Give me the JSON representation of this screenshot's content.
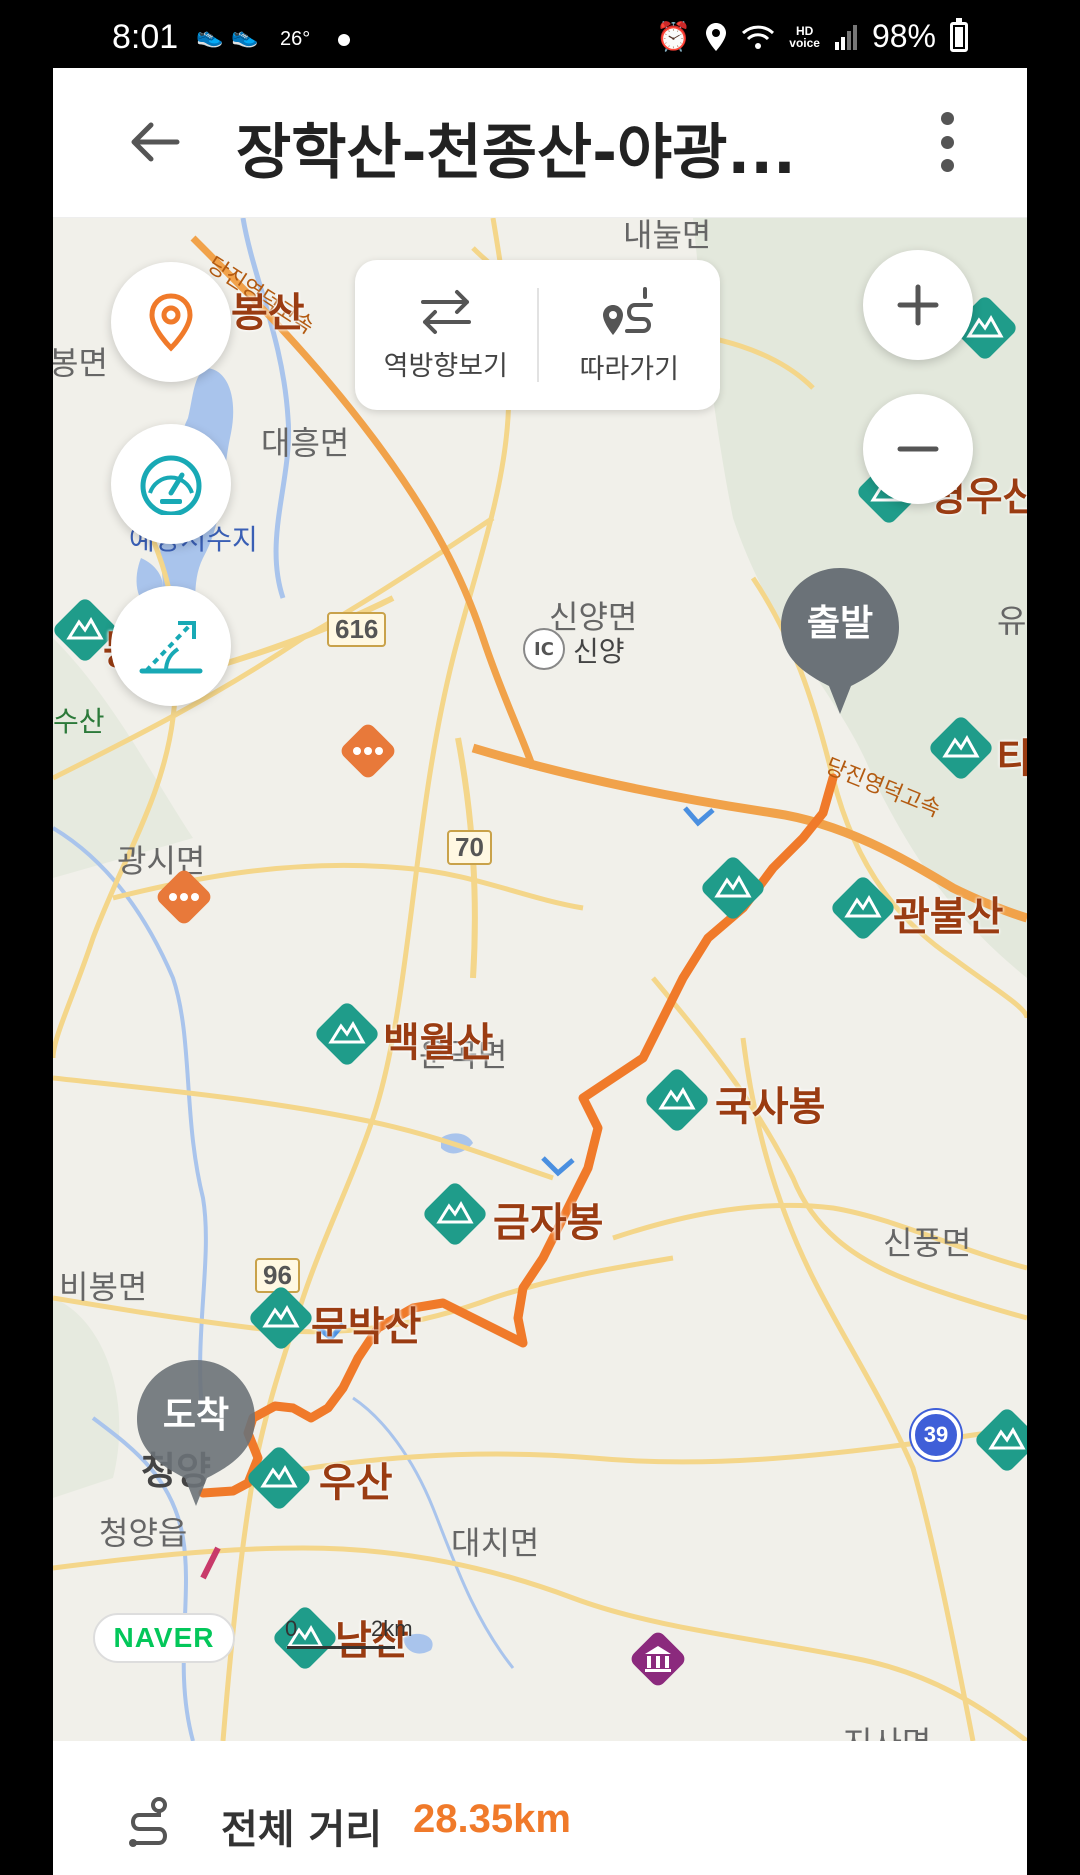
{
  "status_bar": {
    "time": "8:01",
    "temperature": "26°",
    "battery": "98%"
  },
  "header": {
    "title": "장학산-천종산-야광..."
  },
  "toolbar": {
    "reverse_label": "역방향보기",
    "follow_label": "따라가기"
  },
  "map": {
    "places": {
      "naenul": "내눌면",
      "bongmyeon": "봉면",
      "daeheung": "대흥면",
      "sinyang_myeon": "신양면",
      "sinyang": "신양",
      "gwangsi": "광시면",
      "ungok": "운곡면",
      "sinpung": "신풍면",
      "bibong": "비봉면",
      "cheongyang": "청양",
      "cheongyang_eup": "청양읍",
      "daechi": "대치면",
      "yu": "유",
      "jin": "지사면"
    },
    "water_labels": {
      "reservoir": "예당저수지"
    },
    "green_labels": {
      "su_san": "수산"
    },
    "roads": {
      "r616": "616",
      "r70": "70",
      "r96": "96",
      "r39": "39",
      "expressway_north": "당진영덕고속",
      "expressway_east": "당진영덕고속",
      "ic": "IC"
    },
    "peaks": {
      "bongsan": "봉산",
      "byeongu": "병우산",
      "tae": "타",
      "gwanbul": "관불산",
      "baekwol": "백월산",
      "guksa": "국사봉",
      "geumja": "금자봉",
      "munbak": "문박산",
      "uwsan": "우산",
      "namsan": "남산",
      "left_peak": "봉"
    },
    "markers": {
      "start": "출발",
      "end": "도착"
    },
    "brand": "NAVER",
    "scale": {
      "zero": "0",
      "dist": "2km"
    }
  },
  "summary": {
    "label": "전체 거리",
    "value": "28.35km"
  },
  "colors": {
    "route": "#f07a2a",
    "mountain": "#1f9c8a",
    "marker": "#6b7278",
    "brand_green": "#03c75a"
  }
}
